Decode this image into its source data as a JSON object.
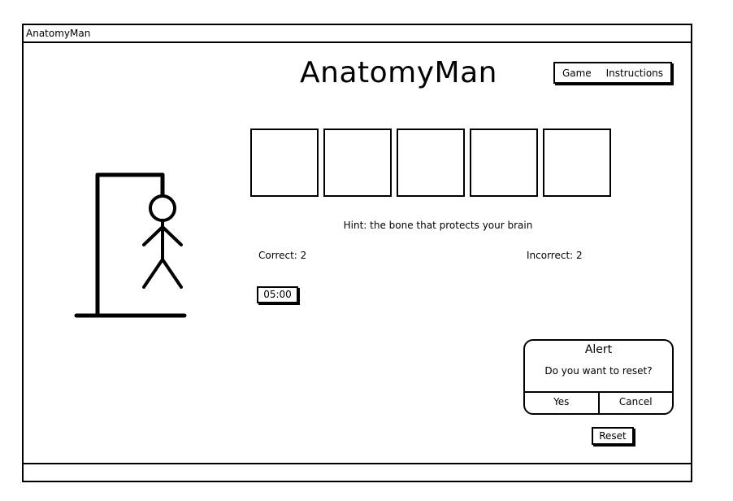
{
  "window": {
    "title": "AnatomyMan"
  },
  "header": {
    "app_title": "AnatomyMan"
  },
  "nav": {
    "items": [
      {
        "label": "Game"
      },
      {
        "label": "Instructions"
      }
    ]
  },
  "game": {
    "letter_slots": [
      "",
      "",
      "",
      "",
      ""
    ],
    "hint": "Hint: the bone that protects your brain",
    "correct_label": "Correct: 2",
    "incorrect_label": "Incorrect: 2",
    "timer": "05:00"
  },
  "alert": {
    "title": "Alert",
    "message": "Do you want to reset?",
    "yes_label": "Yes",
    "cancel_label": "Cancel"
  },
  "controls": {
    "reset_label": "Reset"
  },
  "colors": {
    "ink": "#000000",
    "background": "#ffffff"
  }
}
